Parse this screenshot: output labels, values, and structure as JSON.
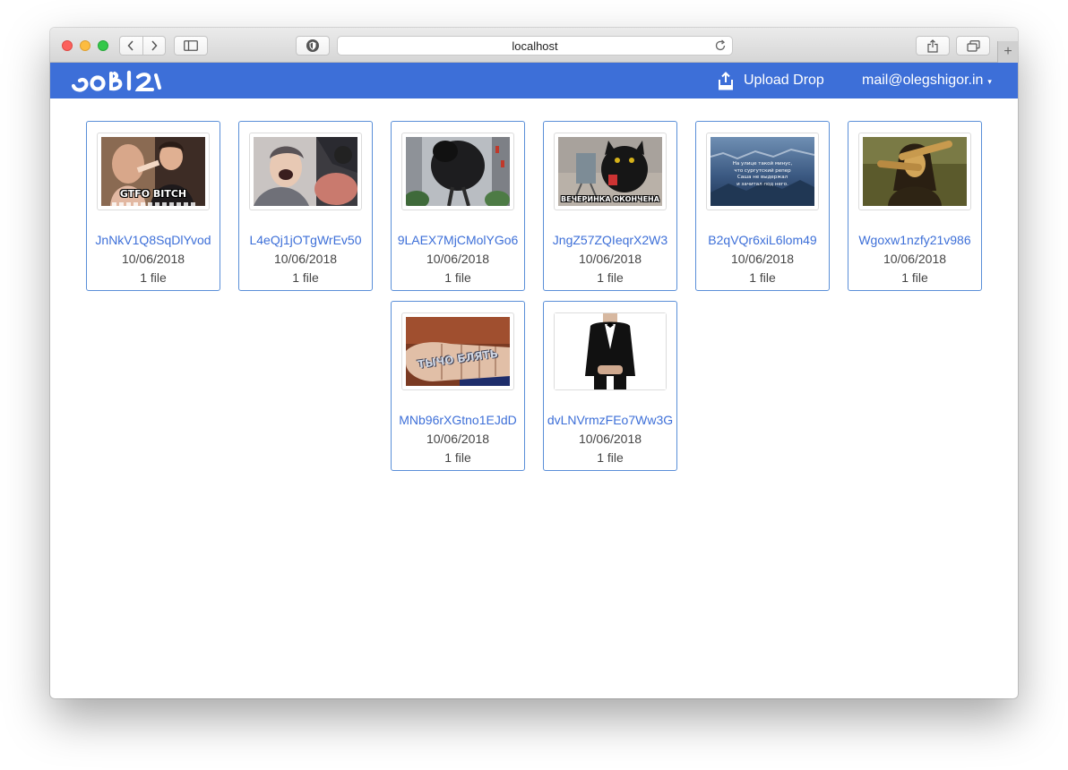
{
  "browser": {
    "address": "localhost"
  },
  "navbar": {
    "logo_text": "ooBla",
    "upload_label": "Upload Drop",
    "account_label": "mail@olegshigor.in",
    "account_caret": "▾"
  },
  "drops": [
    {
      "name": "JnNkV1Q8SqDlYvod",
      "date": "10/06/2018",
      "files": "1 file",
      "caption": "GTFO BITCH",
      "thumb": "thumb-man-gtfo"
    },
    {
      "name": "L4eQj1jOTgWrEv50",
      "date": "10/06/2018",
      "files": "1 file",
      "caption": "",
      "thumb": "thumb-anime-shout"
    },
    {
      "name": "9LAEX7MjCMolYGo6",
      "date": "10/06/2018",
      "files": "1 file",
      "caption": "",
      "thumb": "thumb-giant-bird"
    },
    {
      "name": "JngZ57ZQIeqrX2W3",
      "date": "10/06/2018",
      "files": "1 file",
      "caption": "ВЕЧЕРИНКА ОКОНЧЕНА",
      "thumb": "thumb-black-cat"
    },
    {
      "name": "B2qVQr6xiL6lom49",
      "date": "10/06/2018",
      "files": "1 file",
      "caption": "На улице такой минус, что сургутский репер Саша не выдержал и зачитал под него.",
      "caption_lines": [
        "На улице такой минус,",
        "что сургутский репер",
        "Саша не выдержал",
        "и зачитал под него."
      ],
      "thumb": "thumb-winter-text"
    },
    {
      "name": "Wgoxw1nzfy21v986",
      "date": "10/06/2018",
      "files": "1 file",
      "caption": "",
      "thumb": "thumb-mona-dab"
    },
    {
      "name": "MNb96rXGtno1EJdD",
      "date": "10/06/2018",
      "files": "1 file",
      "caption": "ТЫЧО БЛЯТЬ",
      "thumb": "thumb-fingers"
    },
    {
      "name": "dvLNVrmzFEo7Ww3G",
      "date": "10/06/2018",
      "files": "1 file",
      "caption": "",
      "thumb": "thumb-tuxedo"
    }
  ],
  "colors": {
    "accent": "#3d6fd8",
    "card_border": "#5a8fd8"
  }
}
